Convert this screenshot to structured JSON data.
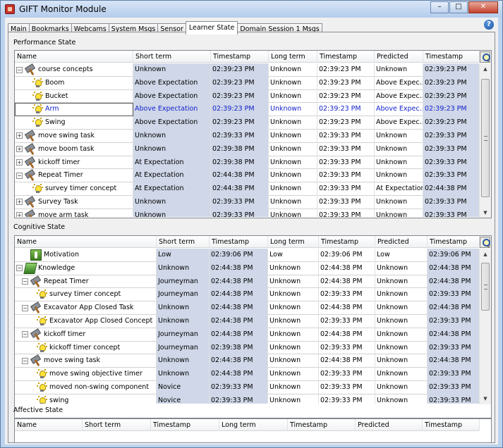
{
  "window": {
    "title": "GIFT Monitor Module",
    "buttons": {
      "minimize": "–",
      "maximize": "□",
      "close": "✕"
    }
  },
  "tabs": [
    "Main",
    "Bookmarks",
    "Webcams",
    "System Msgs",
    "Sensor",
    "Learner State",
    "Domain Session 1 Msgs"
  ],
  "active_tab": "Learner State",
  "help_label": "?",
  "scroll_arrows": {
    "up": "▲",
    "down": "▼"
  },
  "sections": {
    "performance": {
      "title": "Performance State",
      "columns": [
        "Name",
        "Short term",
        "Timestamp",
        "Long term",
        "Timestamp",
        "Predicted",
        "Timestamp"
      ],
      "rows": [
        {
          "exp": "−",
          "icon": "hammer",
          "name": "course concepts",
          "values": [
            "Unknown",
            "02:39:23 PM",
            "Unknown",
            "02:39:23 PM",
            "Unknown",
            "02:39:23 PM"
          ]
        },
        {
          "icon": "bulb",
          "name": "Boom",
          "values": [
            "Above Expectation",
            "02:39:23 PM",
            "Unknown",
            "02:39:23 PM",
            "Above Expec...",
            "02:39:23 PM"
          ]
        },
        {
          "icon": "bulb",
          "name": "Bucket",
          "values": [
            "Above Expectation",
            "02:39:23 PM",
            "Unknown",
            "02:39:23 PM",
            "Above Expec...",
            "02:39:23 PM"
          ]
        },
        {
          "icon": "bulb",
          "name": "Arm",
          "selected": true,
          "values": [
            "Above Expectation",
            "02:39:23 PM",
            "Unknown",
            "02:39:23 PM",
            "Above Expec...",
            "02:39:23 PM"
          ]
        },
        {
          "icon": "bulb",
          "name": "Swing",
          "values": [
            "Above Expectation",
            "02:39:23 PM",
            "Unknown",
            "02:39:23 PM",
            "Above Expec...",
            "02:39:23 PM"
          ]
        },
        {
          "exp": "+",
          "icon": "hammer",
          "name": "move swing task",
          "values": [
            "Unknown",
            "02:39:33 PM",
            "Unknown",
            "02:39:33 PM",
            "Unknown",
            "02:39:33 PM"
          ]
        },
        {
          "exp": "+",
          "icon": "hammer",
          "name": "move boom task",
          "values": [
            "Unknown",
            "02:39:38 PM",
            "Unknown",
            "02:39:33 PM",
            "Unknown",
            "02:39:33 PM"
          ]
        },
        {
          "exp": "+",
          "icon": "hammer",
          "name": "kickoff timer",
          "values": [
            "At Expectation",
            "02:39:38 PM",
            "Unknown",
            "02:39:33 PM",
            "Unknown",
            "02:39:33 PM"
          ]
        },
        {
          "exp": "−",
          "icon": "hammer",
          "name": "Repeat Timer",
          "values": [
            "At Expectation",
            "02:44:38 PM",
            "Unknown",
            "02:39:33 PM",
            "Unknown",
            "02:39:33 PM"
          ]
        },
        {
          "icon": "bulb",
          "name": "survey timer concept",
          "values": [
            "At Expectation",
            "02:44:38 PM",
            "Unknown",
            "02:39:33 PM",
            "At Expectation",
            "02:44:38 PM"
          ]
        },
        {
          "exp": "+",
          "icon": "hammer",
          "name": "Survey Task",
          "values": [
            "Unknown",
            "02:39:33 PM",
            "Unknown",
            "02:39:33 PM",
            "Unknown",
            "02:39:33 PM"
          ]
        },
        {
          "exp": "+",
          "icon": "hammer",
          "name": "move arm task",
          "values": [
            "Unknown",
            "02:39:33 PM",
            "Unknown",
            "02:39:33 PM",
            "Unknown",
            "02:39:33 PM"
          ]
        }
      ]
    },
    "cognitive": {
      "title": "Cognitive State",
      "columns": [
        "Name",
        "Short term",
        "Timestamp",
        "Long term",
        "Timestamp",
        "Predicted",
        "Timestamp"
      ],
      "rows": [
        {
          "icon": "motivation",
          "name": "Motivation",
          "values": [
            "Low",
            "02:39:06 PM",
            "Low",
            "02:39:06 PM",
            "Low",
            "02:39:06 PM"
          ]
        },
        {
          "exp": "−",
          "icon": "knowledge",
          "name": "Knowledge",
          "values": [
            "Unknown",
            "02:44:38 PM",
            "Unknown",
            "02:44:38 PM",
            "Unknown",
            "02:44:38 PM"
          ]
        },
        {
          "exp": "−",
          "icon": "hammer",
          "name": "Repeat Timer",
          "values": [
            "Journeyman",
            "02:44:38 PM",
            "Unknown",
            "02:44:38 PM",
            "Unknown",
            "02:44:38 PM"
          ]
        },
        {
          "icon": "bulb",
          "name": "survey timer concept",
          "values": [
            "Journeyman",
            "02:44:38 PM",
            "Unknown",
            "02:39:33 PM",
            "Unknown",
            "02:39:33 PM"
          ]
        },
        {
          "exp": "−",
          "icon": "hammer",
          "name": "Excavator App Closed Task",
          "values": [
            "Unknown",
            "02:44:38 PM",
            "Unknown",
            "02:44:38 PM",
            "Unknown",
            "02:44:38 PM"
          ]
        },
        {
          "icon": "bulb",
          "name": "Excavator App Closed Concept",
          "values": [
            "Unknown",
            "02:44:38 PM",
            "Unknown",
            "02:39:33 PM",
            "Unknown",
            "02:39:33 PM"
          ]
        },
        {
          "exp": "−",
          "icon": "hammer",
          "name": "kickoff timer",
          "values": [
            "Journeyman",
            "02:44:38 PM",
            "Unknown",
            "02:44:38 PM",
            "Unknown",
            "02:44:38 PM"
          ]
        },
        {
          "icon": "bulb",
          "name": "kickoff timer concept",
          "values": [
            "Journeyman",
            "02:39:38 PM",
            "Unknown",
            "02:39:33 PM",
            "Unknown",
            "02:39:33 PM"
          ]
        },
        {
          "exp": "−",
          "icon": "hammer",
          "name": "move swing task",
          "values": [
            "Unknown",
            "02:44:38 PM",
            "Unknown",
            "02:44:38 PM",
            "Unknown",
            "02:44:38 PM"
          ]
        },
        {
          "icon": "bulb",
          "name": "move swing objective timer",
          "values": [
            "Unknown",
            "02:44:38 PM",
            "Unknown",
            "02:39:33 PM",
            "Unknown",
            "02:39:33 PM"
          ]
        },
        {
          "icon": "bulb",
          "name": "moved non-swing component",
          "values": [
            "Novice",
            "02:39:33 PM",
            "Unknown",
            "02:39:33 PM",
            "Unknown",
            "02:39:33 PM"
          ]
        },
        {
          "icon": "bulb",
          "name": "swing",
          "values": [
            "Novice",
            "02:39:33 PM",
            "Unknown",
            "02:39:33 PM",
            "Unknown",
            "02:39:33 PM"
          ]
        }
      ]
    },
    "affective": {
      "title": "Affective State",
      "columns": [
        "Name",
        "Short term",
        "Timestamp",
        "Long term",
        "Timestamp",
        "Predicted",
        "Timestamp"
      ],
      "rows": []
    }
  }
}
